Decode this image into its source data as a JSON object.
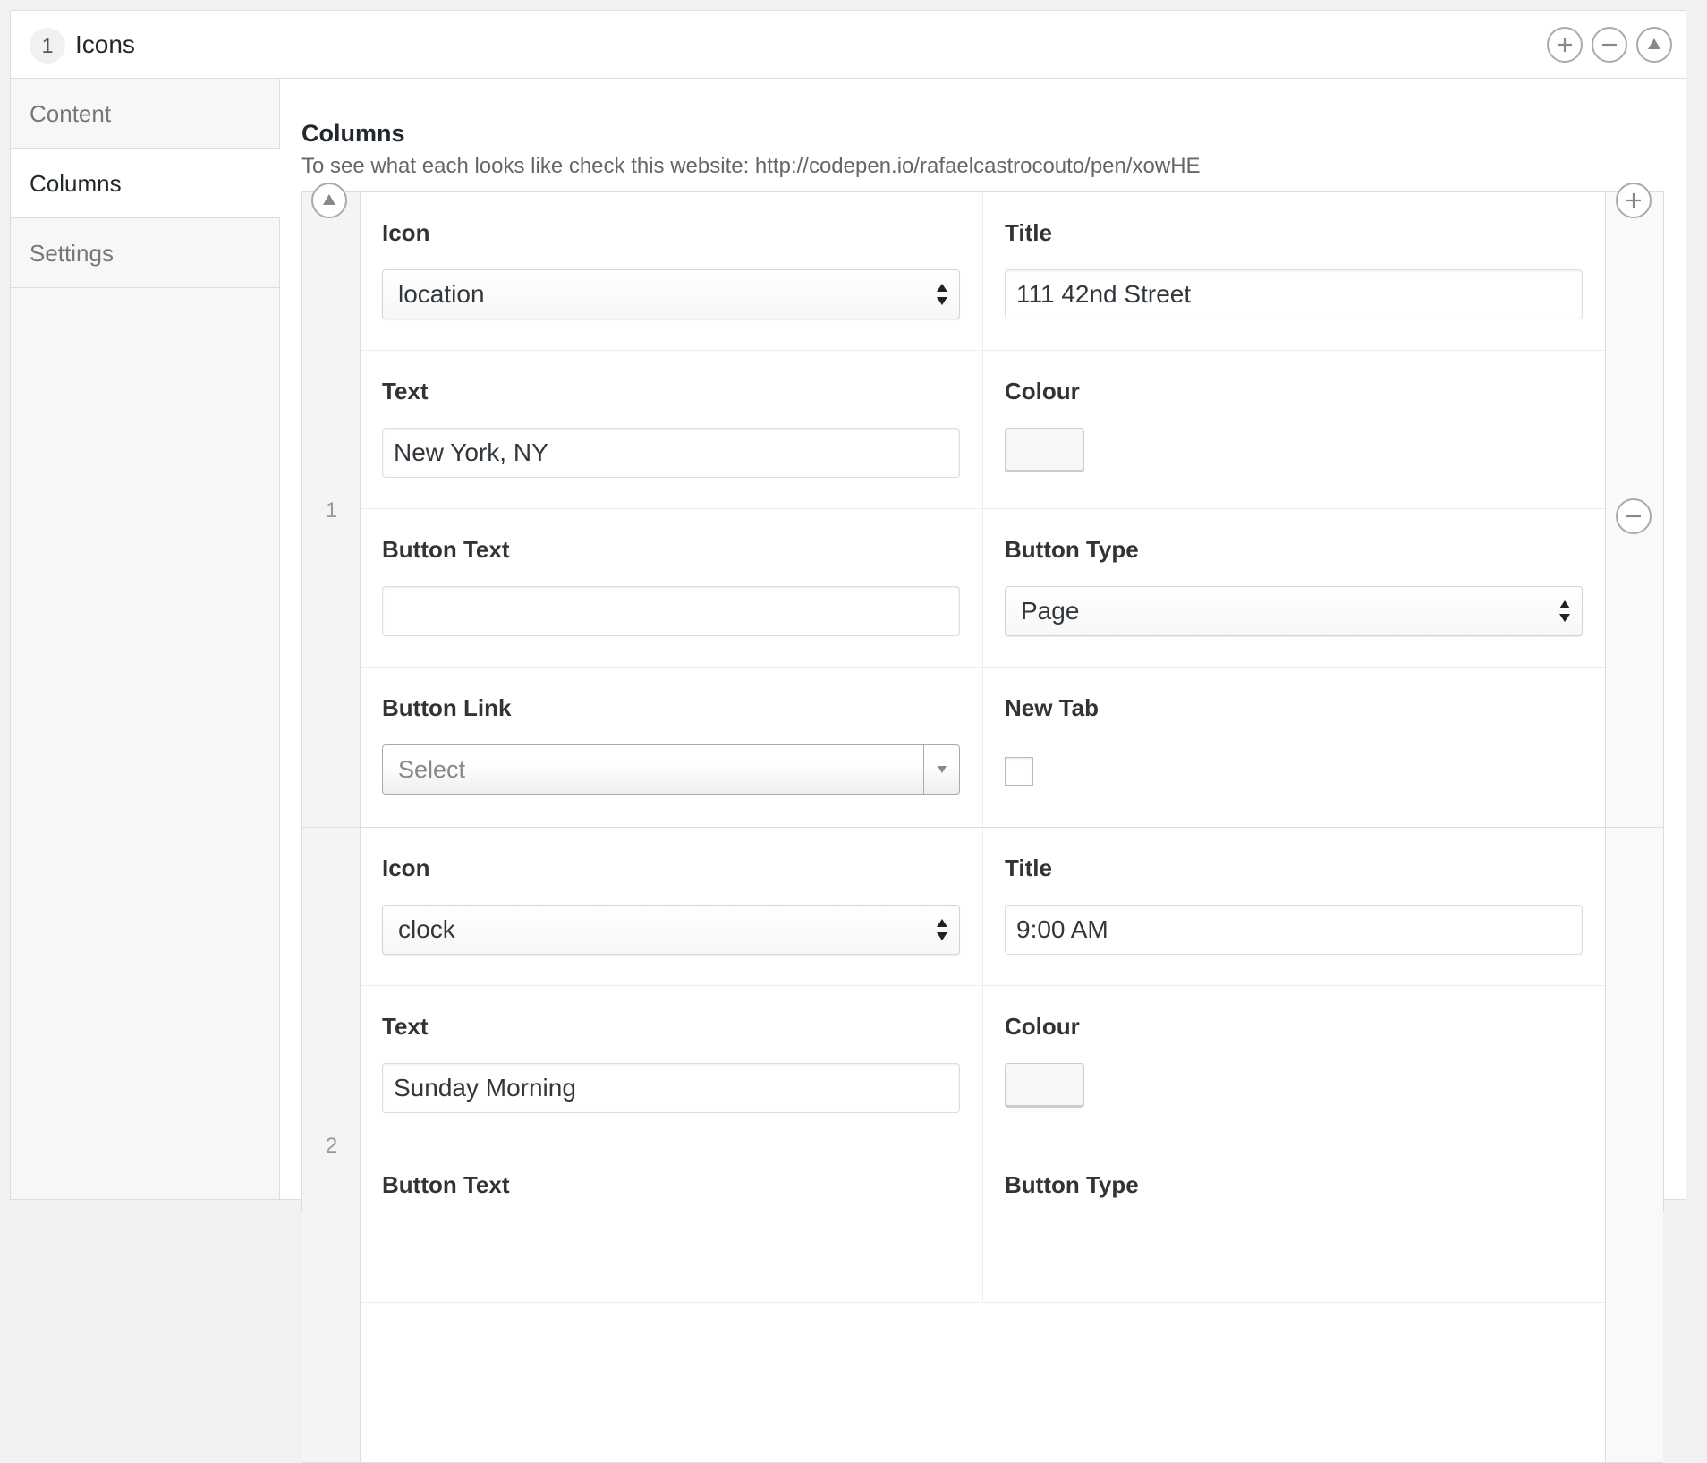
{
  "layout": {
    "number": "1",
    "title": "Icons"
  },
  "tabs": [
    {
      "label": "Content",
      "active": false
    },
    {
      "label": "Columns",
      "active": true
    },
    {
      "label": "Settings",
      "active": false
    }
  ],
  "field": {
    "label": "Columns",
    "description": "To see what each looks like check this website: http://codepen.io/rafaelcastrocouto/pen/xowHE"
  },
  "icons": {
    "add": "plus-circle-icon",
    "remove": "minus-circle-icon",
    "collapse": "triangle-up-icon",
    "select_arrows": "up-down-arrows-icon",
    "dropdown": "triangle-down-icon"
  },
  "colors": {
    "border": "#dddddd",
    "background": "#f1f1f1",
    "text": "#23282d"
  },
  "rows": [
    {
      "number": "1",
      "icon_label": "Icon",
      "icon_value": "location",
      "title_label": "Title",
      "title_value": "111 42nd Street",
      "text_label": "Text",
      "text_value": "New York, NY",
      "colour_label": "Colour",
      "button_text_label": "Button Text",
      "button_text_value": "",
      "button_type_label": "Button Type",
      "button_type_value": "Page",
      "button_link_label": "Button Link",
      "button_link_placeholder": "Select",
      "new_tab_label": "New Tab"
    },
    {
      "number": "2",
      "icon_label": "Icon",
      "icon_value": "clock",
      "title_label": "Title",
      "title_value": "9:00 AM",
      "text_label": "Text",
      "text_value": "Sunday Morning",
      "colour_label": "Colour",
      "button_text_label": "Button Text",
      "button_type_label": "Button Type"
    }
  ]
}
